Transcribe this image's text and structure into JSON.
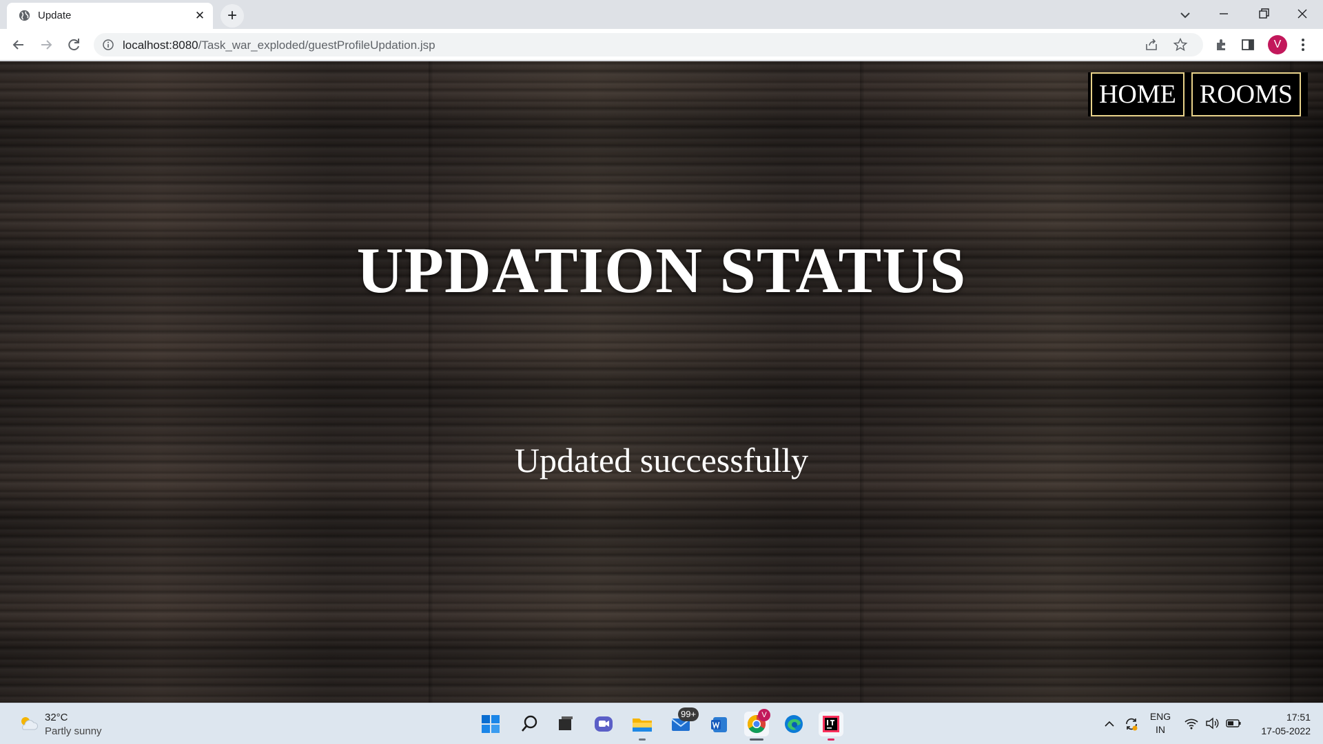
{
  "browser": {
    "tab_title": "Update",
    "new_tab_symbol": "+",
    "close_tab_symbol": "✕",
    "url_host": "localhost:8080",
    "url_path": "/Task_war_exploded/guestProfileUpdation.jsp",
    "profile_initial": "V"
  },
  "page": {
    "nav": [
      {
        "label": "HOME"
      },
      {
        "label": "ROOMS"
      }
    ],
    "heading": "UPDATION STATUS",
    "status_message": "Updated successfully",
    "nav_border_color": "#e8d28a"
  },
  "taskbar": {
    "weather_temp": "32°C",
    "weather_desc": "Partly sunny",
    "mail_badge": "99+",
    "chrome_badge": "V",
    "language_line1": "ENG",
    "language_line2": "IN",
    "time": "17:51",
    "date": "17-05-2022",
    "icons": [
      "start-icon",
      "search-icon",
      "task-view-icon",
      "chat-icon",
      "file-explorer-icon",
      "mail-icon",
      "word-icon",
      "chrome-icon",
      "edge-icon",
      "intellij-icon"
    ]
  }
}
